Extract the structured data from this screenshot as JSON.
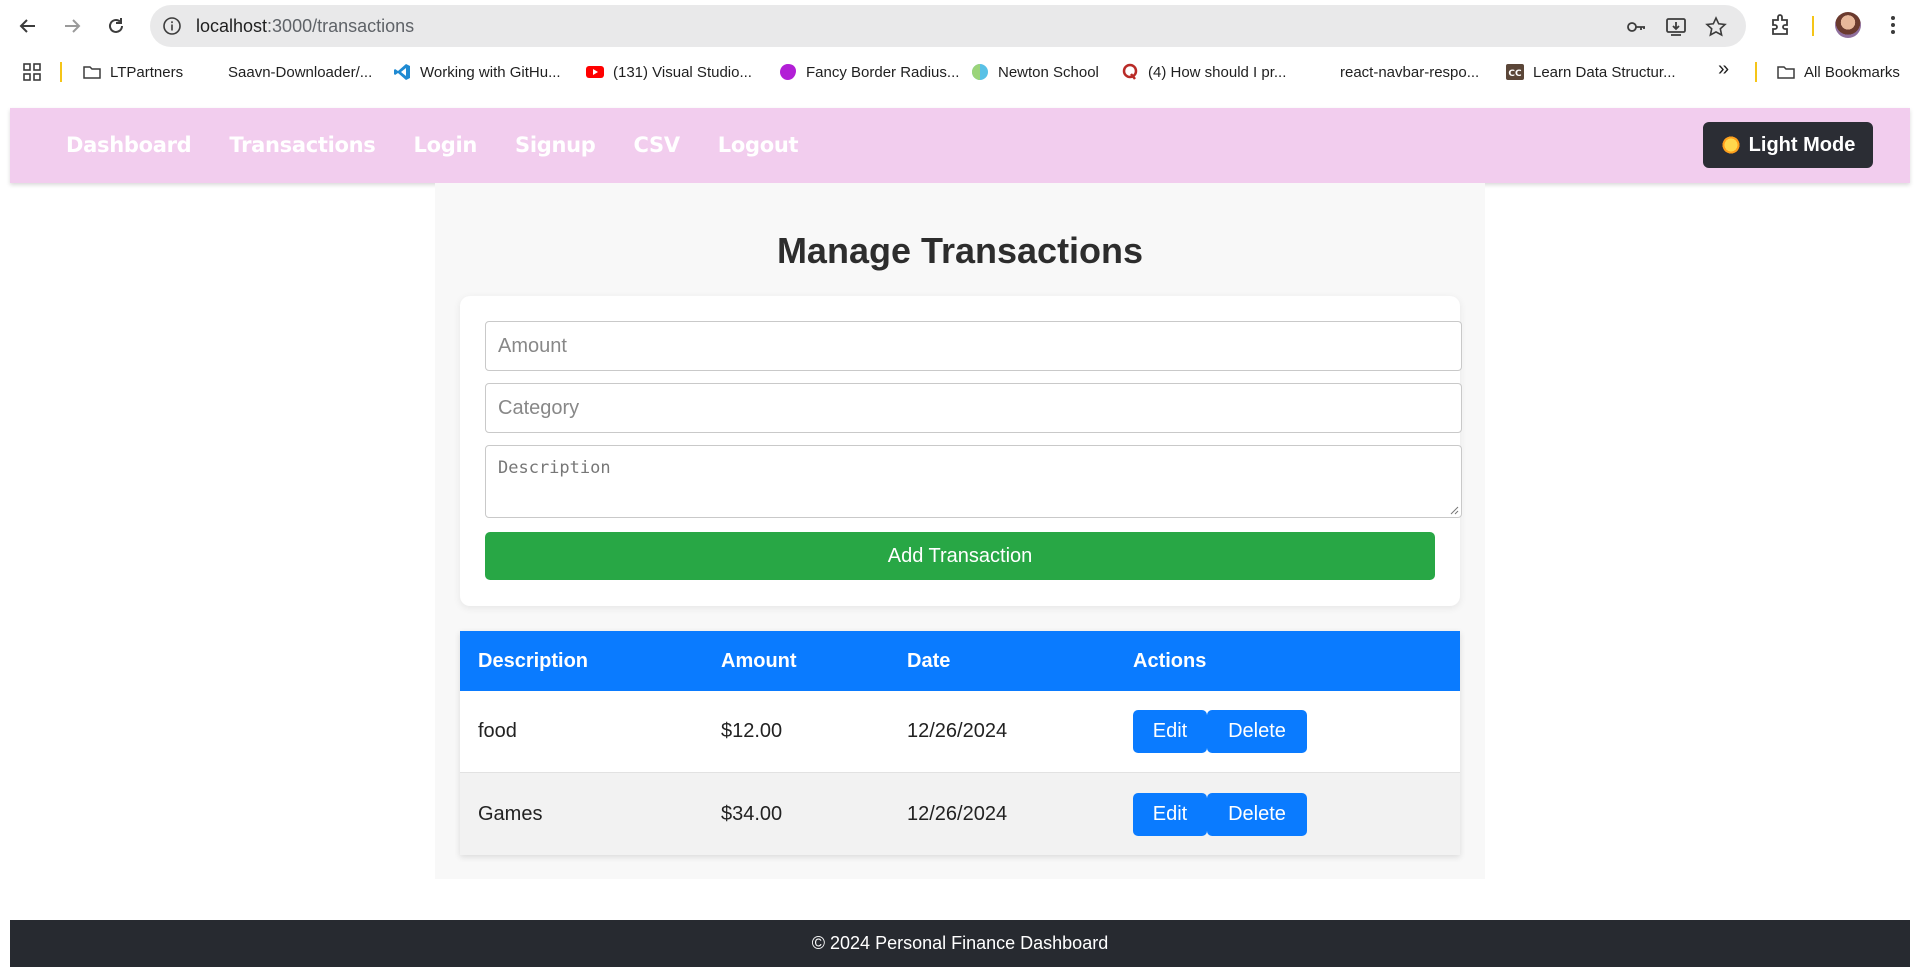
{
  "browser": {
    "url_host": "localhost",
    "url_path": ":3000/transactions",
    "bookmarks": [
      {
        "label": "LTPartners",
        "icon": "folder-icon"
      },
      {
        "label": "Saavn-Downloader/...",
        "icon": "github-icon"
      },
      {
        "label": "Working with GitHu...",
        "icon": "vscode-icon"
      },
      {
        "label": "(131) Visual Studio...",
        "icon": "youtube-icon"
      },
      {
        "label": "Fancy Border Radius...",
        "icon": "blob-icon"
      },
      {
        "label": "Newton School",
        "icon": "newton-icon"
      },
      {
        "label": "(4) How should I pr...",
        "icon": "quora-icon"
      },
      {
        "label": "react-navbar-respo...",
        "icon": "github-icon"
      },
      {
        "label": "Learn Data Structur...",
        "icon": "codechef-icon"
      }
    ],
    "overflow_label": "»",
    "all_bookmarks_label": "All Bookmarks"
  },
  "nav": {
    "links": [
      "Dashboard",
      "Transactions",
      "Login",
      "Signup",
      "CSV",
      "Logout"
    ],
    "mode_button": "Light Mode"
  },
  "page": {
    "title": "Manage Transactions",
    "form": {
      "amount_placeholder": "Amount",
      "category_placeholder": "Category",
      "description_placeholder": "Description",
      "submit_label": "Add Transaction"
    },
    "table": {
      "headers": [
        "Description",
        "Amount",
        "Date",
        "Actions"
      ],
      "rows": [
        {
          "description": "food",
          "amount": "$12.00",
          "date": "12/26/2024"
        },
        {
          "description": "Games",
          "amount": "$34.00",
          "date": "12/26/2024"
        }
      ],
      "edit_label": "Edit",
      "delete_label": "Delete"
    }
  },
  "footer": {
    "text": "© 2024 Personal Finance Dashboard"
  },
  "colors": {
    "nav_bg": "#f2cdee",
    "primary": "#0a7bff",
    "success": "#28a745",
    "footer_bg": "#272a30"
  }
}
